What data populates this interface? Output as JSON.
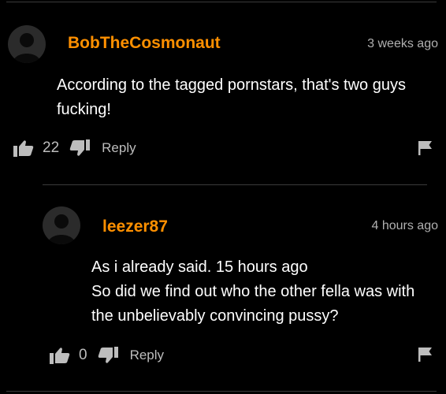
{
  "comments": [
    {
      "username": "BobTheCosmonaut",
      "timestamp": "3 weeks ago",
      "lines": [
        "According to the tagged pornstars, that's two guys",
        "fucking!"
      ],
      "likes": "22",
      "reply_label": "Reply",
      "icons": {
        "avatar": "user-avatar-icon",
        "like": "thumbs-up-icon",
        "dislike": "thumbs-down-icon",
        "flag": "flag-icon"
      }
    },
    {
      "username": "leezer87",
      "timestamp": "4 hours ago",
      "lines": [
        "As i already said. 15 hours ago",
        "So did we find out who the other fella was with",
        "the unbelievably convincing pussy?"
      ],
      "likes": "0",
      "reply_label": "Reply",
      "icons": {
        "avatar": "user-avatar-icon",
        "like": "thumbs-up-icon",
        "dislike": "thumbs-down-icon",
        "flag": "flag-icon"
      }
    }
  ],
  "colors": {
    "background": "#000000",
    "username": "#ff9000",
    "text": "#ffffff",
    "muted": "#bdbdbd",
    "avatar": "#2b2b2b",
    "divider": "#3a3a3a"
  }
}
